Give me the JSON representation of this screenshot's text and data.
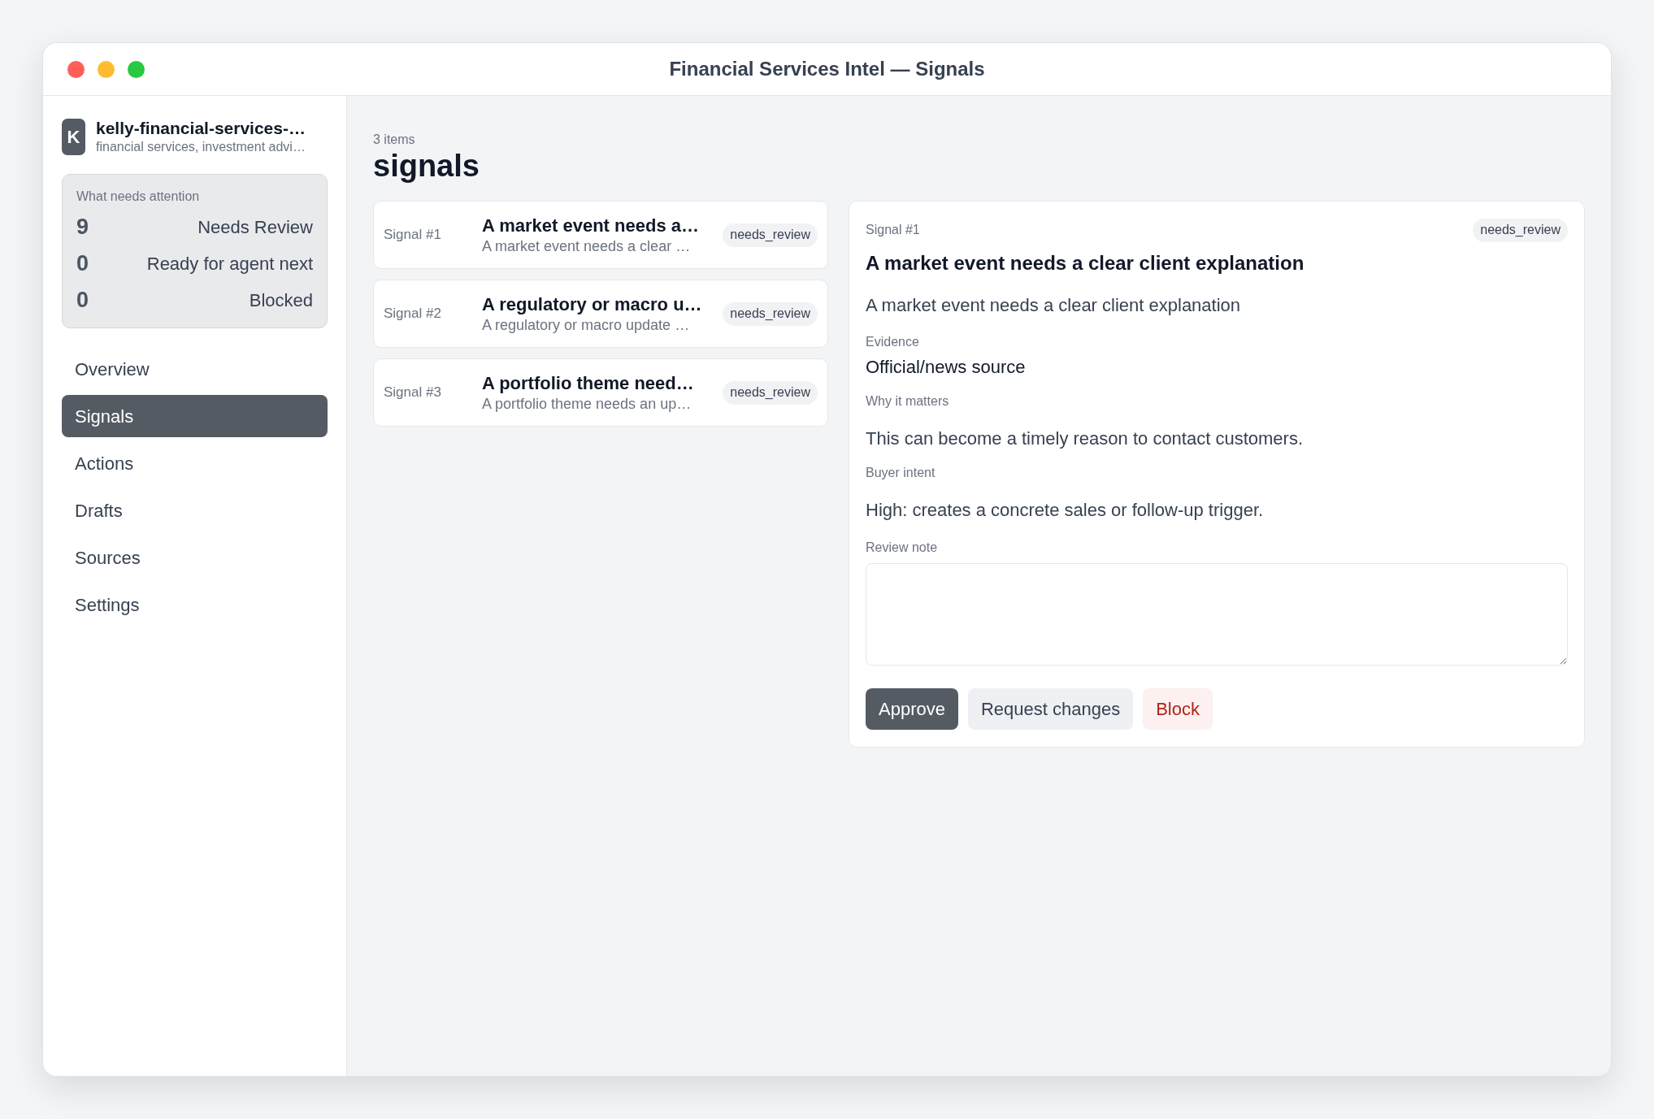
{
  "window": {
    "title": "Financial Services Intel — Signals"
  },
  "sidebar": {
    "workspace": {
      "initial": "K",
      "name": "kelly-financial-services-…",
      "subtitle": "financial services, investment advi…"
    },
    "attention": {
      "title": "What needs attention",
      "rows": [
        {
          "count": "9",
          "label": "Needs Review"
        },
        {
          "count": "0",
          "label": "Ready for agent next"
        },
        {
          "count": "0",
          "label": "Blocked"
        }
      ]
    },
    "nav": [
      {
        "label": "Overview",
        "selected": false
      },
      {
        "label": "Signals",
        "selected": true
      },
      {
        "label": "Actions",
        "selected": false
      },
      {
        "label": "Drafts",
        "selected": false
      },
      {
        "label": "Sources",
        "selected": false
      },
      {
        "label": "Settings",
        "selected": false
      }
    ]
  },
  "main": {
    "count_label": "3 items",
    "heading": "signals",
    "signals": [
      {
        "number": "Signal #1",
        "title": "A market event needs a…",
        "summary": "A market event needs a clear …",
        "status": "needs_review"
      },
      {
        "number": "Signal #2",
        "title": "A regulatory or macro u…",
        "summary": "A regulatory or macro update …",
        "status": "needs_review"
      },
      {
        "number": "Signal #3",
        "title": "A portfolio theme need…",
        "summary": "A portfolio theme needs an up…",
        "status": "needs_review"
      }
    ],
    "detail": {
      "number": "Signal #1",
      "status": "needs_review",
      "title": "A market event needs a clear client explanation",
      "description": "A market event needs a clear client explanation",
      "fields": [
        {
          "kind": "compact",
          "label": "Evidence",
          "value": "Official/news source"
        },
        {
          "kind": "paragraph",
          "label": "Why it matters",
          "value": "This can become a timely reason to contact customers."
        },
        {
          "kind": "paragraph",
          "label": "Buyer intent",
          "value": "High: creates a concrete sales or follow-up trigger."
        }
      ],
      "review_note": {
        "label": "Review note"
      },
      "actions": [
        {
          "kind": "approve",
          "label": "Approve"
        },
        {
          "kind": "revise",
          "label": "Request changes"
        },
        {
          "kind": "block",
          "label": "Block"
        }
      ]
    }
  }
}
